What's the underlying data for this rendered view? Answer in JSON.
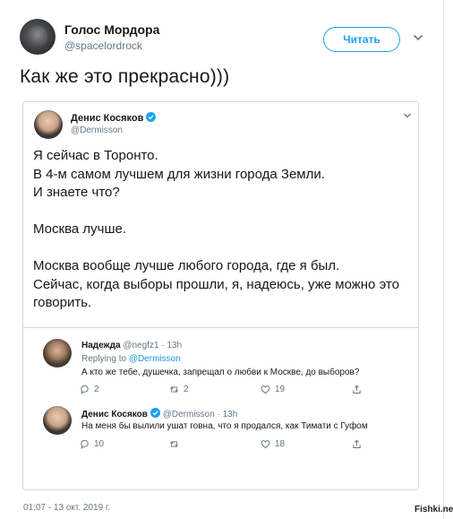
{
  "tweet": {
    "author_name": "Голос Мордора",
    "author_handle": "@spacelordrock",
    "follow_label": "Читать",
    "text": "Как же это прекрасно)))",
    "timestamp": "01:07 - 13 окт. 2019 г."
  },
  "quoted": {
    "author_name": "Денис Косяков",
    "author_handle": "@Dermisson",
    "lines": [
      "Я сейчас в Торонто.",
      "В 4-м самом лучшем для жизни города Земли.",
      "И знаете что?",
      "",
      "Москва лучше.",
      "",
      "Москва вообще лучше любого города, где я был.",
      "Сейчас, когда выборы прошли, я, надеюсь, уже можно это",
      "говорить."
    ]
  },
  "replies": [
    {
      "name": "Надежда",
      "handle": "@negfz1",
      "separator": "·",
      "time": "13h",
      "replying_prefix": "Replying to",
      "replying_to": "@Dermisson",
      "text": "А кто же тебе, душечка, запрещал о любви к Москве, до выборов?",
      "reply_count": "2",
      "retweet_count": "2",
      "like_count": "19"
    },
    {
      "name": "Денис Косяков",
      "handle": "@Dermisson",
      "separator": "·",
      "time": "13h",
      "text": "На меня бы вылили ушат говна, что я продался, как Тимати с Гуфом",
      "reply_count": "10",
      "retweet_count": "",
      "like_count": "18"
    }
  ],
  "watermark": "Fishki.net",
  "colors": {
    "accent": "#1da1f2",
    "muted": "#657786",
    "border": "#cfd9de"
  },
  "icons": [
    "chevron-down-icon",
    "verified-badge-icon",
    "reply-icon",
    "retweet-icon",
    "like-icon",
    "share-icon"
  ]
}
